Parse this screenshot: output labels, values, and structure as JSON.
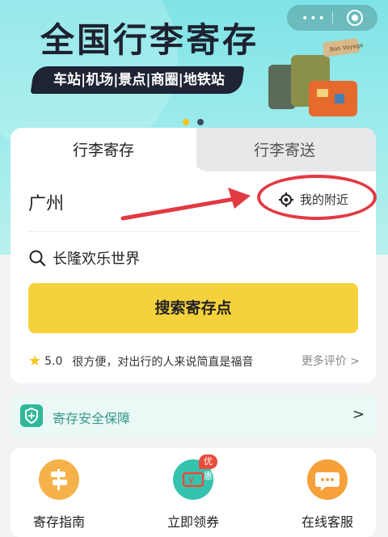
{
  "banner": {
    "title": "全国行李寄存",
    "subtitle": "车站|机场|景点|商圈|地铁站",
    "luggage_tag": "Bon Voyage",
    "pagination": {
      "count": 2,
      "active_index": 0
    }
  },
  "capsule": {
    "more_glyph": "•••",
    "close_icon": "record-icon"
  },
  "tabs": {
    "active": "行李寄存",
    "inactive": "行李寄送"
  },
  "location": {
    "city": "广州",
    "nearby_label": "我的附近"
  },
  "search": {
    "placeholder_text": "长隆欢乐世界",
    "button_label": "搜索寄存点"
  },
  "review": {
    "score": "5.0",
    "text": "很方便，对出行的人来说简直是福音",
    "more_label": "更多评价 >"
  },
  "safety": {
    "label": "寄存安全保障",
    "chevron": ">"
  },
  "quick_actions": [
    {
      "label": "寄存指南",
      "icon": "signpost-icon"
    },
    {
      "label": "立即领券",
      "icon": "coupon-icon",
      "badge": "优惠"
    },
    {
      "label": "在线客服",
      "icon": "chat-icon"
    }
  ],
  "colors": {
    "banner_bg": "#7fe3e6",
    "primary_button": "#f5d23c",
    "annotation_red": "#e23a43",
    "safety_green": "#2fb99a",
    "badge_red": "#e94b3c"
  }
}
